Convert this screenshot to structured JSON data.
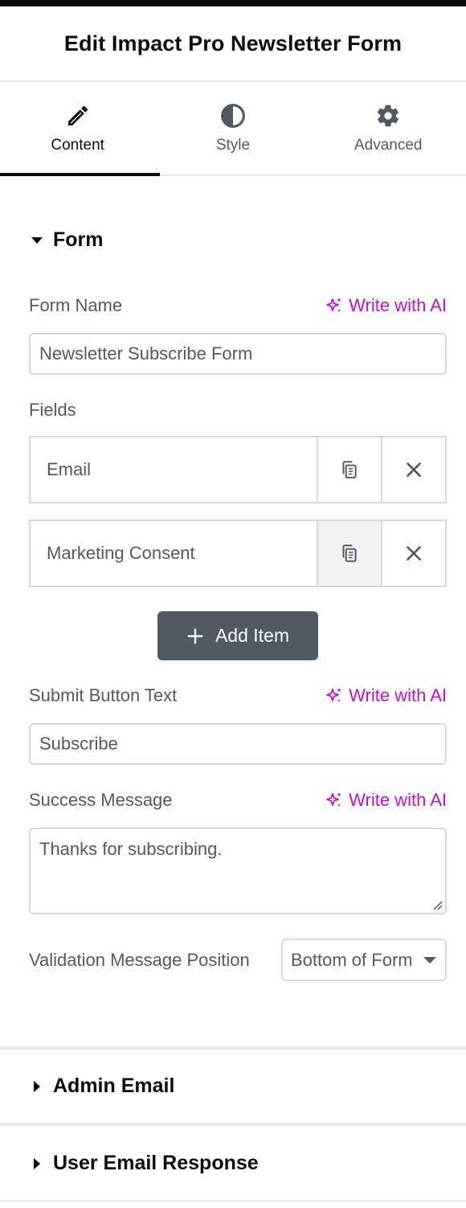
{
  "header": {
    "title": "Edit Impact Pro Newsletter Form"
  },
  "tabs": [
    {
      "label": "Content",
      "icon": "pencil-icon",
      "active": true
    },
    {
      "label": "Style",
      "icon": "contrast-icon",
      "active": false
    },
    {
      "label": "Advanced",
      "icon": "gear-icon",
      "active": false
    }
  ],
  "form_section": {
    "title": "Form",
    "form_name": {
      "label": "Form Name",
      "value": "Newsletter Subscribe Form"
    },
    "write_ai_label": "Write with AI",
    "fields": {
      "label": "Fields",
      "items": [
        {
          "title": "Email"
        },
        {
          "title": "Marketing Consent"
        }
      ],
      "add_label": "Add Item"
    },
    "submit_button": {
      "label": "Submit Button Text",
      "value": "Subscribe"
    },
    "success_message": {
      "label": "Success Message",
      "value": "Thanks for subscribing."
    },
    "validation_position": {
      "label": "Validation Message Position",
      "selected": "Bottom of Form"
    }
  },
  "collapsed_sections": [
    {
      "title": "Admin Email"
    },
    {
      "title": "User Email Response"
    }
  ],
  "colors": {
    "accent_ai": "#c40ed6",
    "button_bg": "#515962",
    "text": "#515962",
    "heading": "#0c0d0e"
  }
}
